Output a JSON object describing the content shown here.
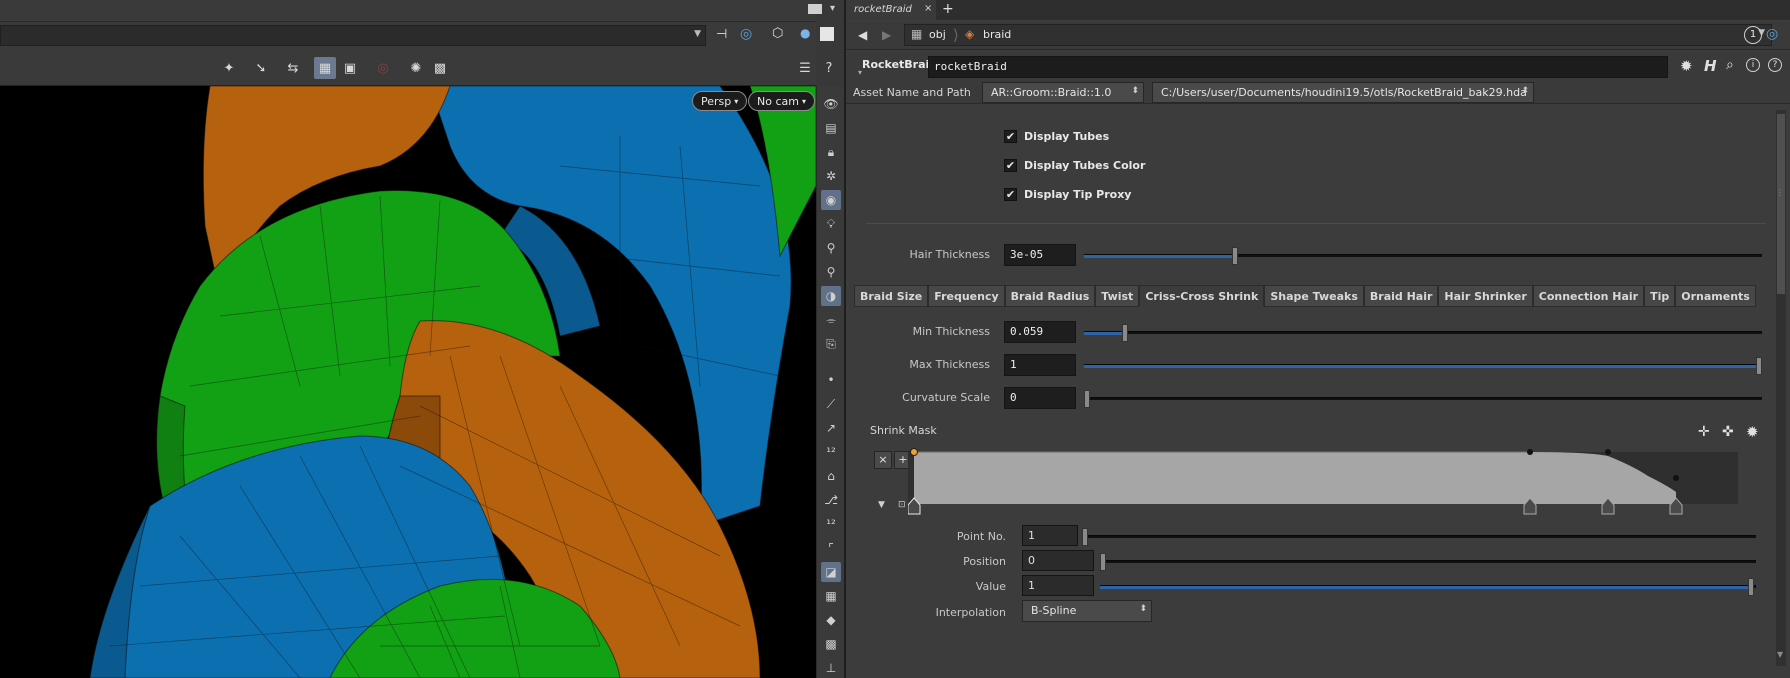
{
  "viewport": {
    "persp_label": "Persp",
    "cam_label": "No cam",
    "colors": {
      "orange": "#b8620e",
      "green": "#13a316",
      "blue": "#0b72b5"
    }
  },
  "tabs": {
    "active_title": "rocketBraid",
    "close": "×",
    "add": "+"
  },
  "nav": {
    "back": "◀",
    "forward": "▶",
    "obj_label": "obj",
    "node_label": "braid",
    "pin_label": "1"
  },
  "node": {
    "type_label": "RocketBraid",
    "name_value": "rocketBraid"
  },
  "asset": {
    "label": "Asset Name and Path",
    "name": "AR::Groom::Braid::1.0",
    "path": "C:/Users/user/Documents/houdini19.5/otls/RocketBraid_bak29.hda"
  },
  "toggles": [
    {
      "label": "Display Tubes",
      "checked": true
    },
    {
      "label": "Display Tubes Color",
      "checked": true
    },
    {
      "label": "Display Tip Proxy",
      "checked": true
    }
  ],
  "hair_thickness": {
    "label": "Hair Thickness",
    "value": "3e-05",
    "slider_fraction": 0.22
  },
  "param_tabs": [
    "Braid Size",
    "Frequency",
    "Braid Radius",
    "Twist",
    "Criss-Cross Shrink",
    "Shape Tweaks",
    "Braid Hair",
    "Hair Shrinker",
    "Connection Hair",
    "Tip",
    "Ornaments"
  ],
  "active_param_tab": "Criss-Cross Shrink",
  "criss_cross": {
    "min_thickness": {
      "label": "Min Thickness",
      "value": "0.059",
      "slider_fraction": 0.059
    },
    "max_thickness": {
      "label": "Max Thickness",
      "value": "1",
      "slider_fraction": 1.0
    },
    "curvature_scale": {
      "label": "Curvature Scale",
      "value": "0",
      "slider_fraction": 0.0
    },
    "shrink_mask": {
      "label": "Shrink Mask",
      "remove_btn": "×",
      "add_btn": "+",
      "point_no": {
        "label": "Point No.",
        "value": "1"
      },
      "position": {
        "label": "Position",
        "value": "0"
      },
      "value": {
        "label": "Value",
        "value": "1"
      },
      "interpolation": {
        "label": "Interpolation",
        "value": "B-Spline"
      }
    }
  }
}
